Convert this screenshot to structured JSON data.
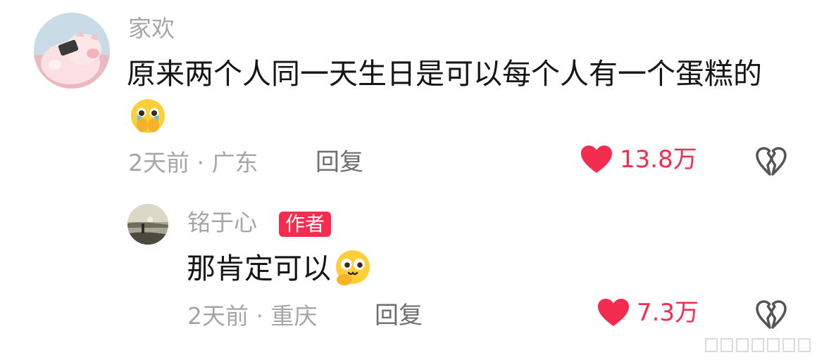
{
  "comment": {
    "username": "家欢",
    "text": "原来两个人同一天生日是可以每个人有一个蛋糕的",
    "time": "2天前",
    "separator": "·",
    "location": "广东",
    "reply_label": "回复",
    "likes": "13.8万",
    "emoji": "crying-face-icon",
    "avatar": "pig-avatar"
  },
  "reply": {
    "username": "铭于心",
    "badge": "作者",
    "text": "那肯定可以",
    "time": "2天前",
    "separator": "·",
    "location": "重庆",
    "reply_label": "回复",
    "likes": "7.3万",
    "emoji": "smirk-thinking-face-icon",
    "avatar": "sunset-lake-avatar"
  },
  "colors": {
    "accent": "#f42c4f",
    "text_primary": "#161616",
    "text_secondary": "#a6a6a6",
    "reply_button": "#6e6e6e"
  }
}
